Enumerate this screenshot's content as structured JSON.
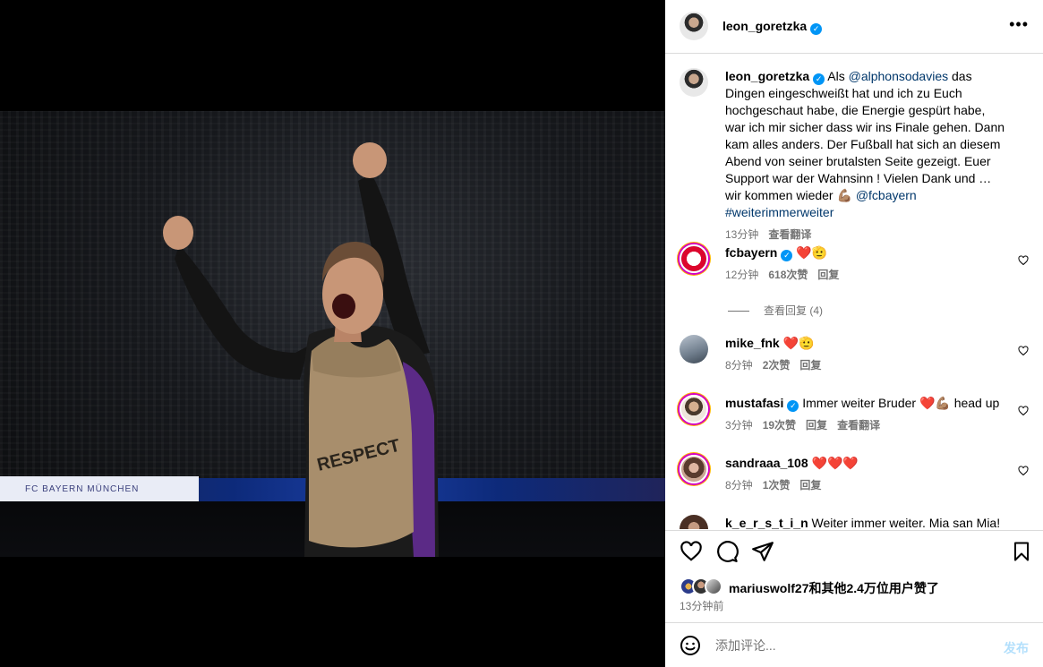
{
  "post": {
    "author": "leon_goretzka",
    "board_text": "FC BAYERN MÜNCHEN"
  },
  "caption": {
    "username": "leon_goretzka",
    "prefix": "Als ",
    "mention1": "@alphonsodavies",
    "text": " das Dingen eingeschweißt hat und ich zu Euch hochgeschaut habe, die Energie gespürt habe, war ich mir sicher dass wir ins Finale gehen. Dann kam alles anders. Der Fußball hat sich an diesem Abend von seiner brutalsten Seite gezeigt. Euer Support war der Wahnsinn ! Vielen Dank und … wir kommen wieder ",
    "emoji": "💪🏽",
    "mention2": "@fcbayern",
    "hashtag": "#weiterimmerweiter",
    "time": "13分钟",
    "translate": "查看翻译"
  },
  "comments": [
    {
      "username": "fcbayern",
      "verified": true,
      "text": "❤️🫡",
      "time": "12分钟",
      "likes": "618次赞",
      "reply": "回复",
      "replies": "查看回复 (4)"
    },
    {
      "username": "mike_fnk",
      "verified": false,
      "text": "❤️🫡",
      "time": "8分钟",
      "likes": "2次赞",
      "reply": "回复"
    },
    {
      "username": "mustafasi",
      "verified": true,
      "text": "Immer weiter Bruder ❤️💪🏽 head up",
      "time": "3分钟",
      "likes": "19次赞",
      "reply": "回复",
      "translate": "查看翻译"
    },
    {
      "username": "sandraaa_108",
      "verified": false,
      "text": "❤️❤️❤️",
      "time": "8分钟",
      "likes": "1次赞",
      "reply": "回复"
    },
    {
      "username": "k_e_r_s_t_i_n",
      "verified": false,
      "text": "Weiter immer weiter. Mia san Mia! In"
    }
  ],
  "likes_text": "mariuswolf27和其他2.4万位用户赞了",
  "post_time": "13分钟前",
  "composer": {
    "placeholder": "添加评论...",
    "post_label": "发布"
  },
  "colors": {
    "verified": "#0095f6",
    "mention": "#00376b",
    "muted": "#737373",
    "post_disabled": "#b2dffc"
  }
}
